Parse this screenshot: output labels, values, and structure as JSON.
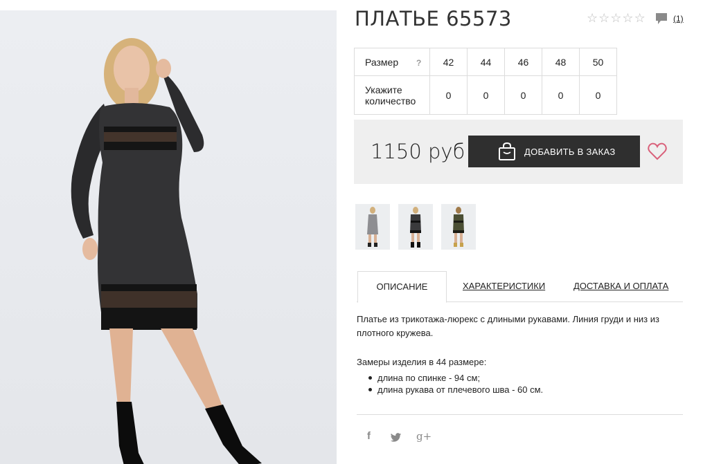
{
  "product": {
    "title": "ПЛАТЬЕ 65573",
    "reviews_count": "(1)",
    "rating_stars": 0,
    "max_stars": 5
  },
  "size_table": {
    "size_label": "Размер",
    "help_mark": "?",
    "sizes": [
      "42",
      "44",
      "46",
      "48",
      "50"
    ],
    "quantity_label_line1": "Укажите",
    "quantity_label_line2": "количество",
    "quantities": [
      "0",
      "0",
      "0",
      "0",
      "0"
    ]
  },
  "purchase": {
    "price": "1150 руб",
    "add_button_label": "ДОБАВИТЬ В ЗАКАЗ"
  },
  "tabs": [
    {
      "label": "ОПИСАНИЕ",
      "active": true
    },
    {
      "label": "ХАРАКТЕРИСТИКИ",
      "active": false
    },
    {
      "label": "ДОСТАВКА И ОПЛАТА",
      "active": false
    }
  ],
  "description": {
    "text": "Платье из трикотажа-люрекс с длиными рукавами. Линия груди и низ из плотного кружева.",
    "measures_title": "Замеры изделия в 44 размере:",
    "measures": [
      "длина по спинке - 94 см;",
      "длина рукава от плечевого шва - 60 см."
    ]
  },
  "social": {
    "facebook": "f",
    "twitter": "twitter-icon",
    "google_plus": "g+"
  },
  "colors": {
    "button_bg": "#2f2f2f",
    "price_box_bg": "#efefef",
    "heart": "#d9607a",
    "border": "#dcdcdc"
  }
}
